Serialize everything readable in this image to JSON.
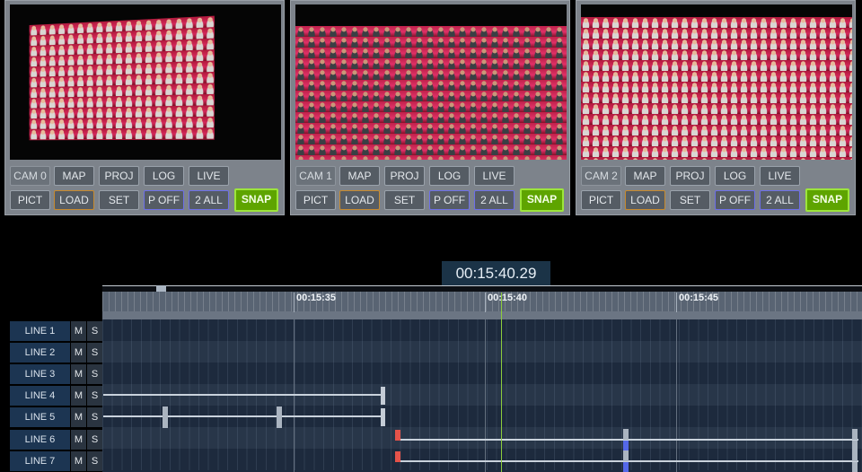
{
  "cameras": [
    {
      "label": "CAM 0",
      "row1": [
        "MAP",
        "PROJ",
        "LOG",
        "LIVE"
      ],
      "row2": [
        "PICT",
        "LOAD",
        "SET",
        "P OFF",
        "2 ALL",
        "SNAP"
      ]
    },
    {
      "label": "CAM 1",
      "row1": [
        "MAP",
        "PROJ",
        "LOG",
        "LIVE"
      ],
      "row2": [
        "PICT",
        "LOAD",
        "SET",
        "P OFF",
        "2 ALL",
        "SNAP"
      ]
    },
    {
      "label": "CAM 2",
      "row1": [
        "MAP",
        "PROJ",
        "LOG",
        "LIVE"
      ],
      "row2": [
        "PICT",
        "LOAD",
        "SET",
        "P OFF",
        "2 ALL",
        "SNAP"
      ]
    }
  ],
  "timeline": {
    "current_time": "00:15:40.29",
    "ruler_labels": [
      "00:15:35",
      "00:15:40",
      "00:15:45"
    ],
    "lines": [
      {
        "label": "LINE 1",
        "mute": "M",
        "solo": "S"
      },
      {
        "label": "LINE 2",
        "mute": "M",
        "solo": "S"
      },
      {
        "label": "LINE 3",
        "mute": "M",
        "solo": "S"
      },
      {
        "label": "LINE 4",
        "mute": "M",
        "solo": "S"
      },
      {
        "label": "LINE 5",
        "mute": "M",
        "solo": "S"
      },
      {
        "label": "LINE 6",
        "mute": "M",
        "solo": "S"
      },
      {
        "label": "LINE 7",
        "mute": "M",
        "solo": "S"
      }
    ]
  },
  "colors": {
    "snap_green": "#5ea400",
    "load_border": "#c78a2e",
    "blue_border": "#6d6fe8",
    "playhead": "#8ccd3d",
    "cue_red": "#e5534a",
    "cue_blue": "#5468e8"
  }
}
